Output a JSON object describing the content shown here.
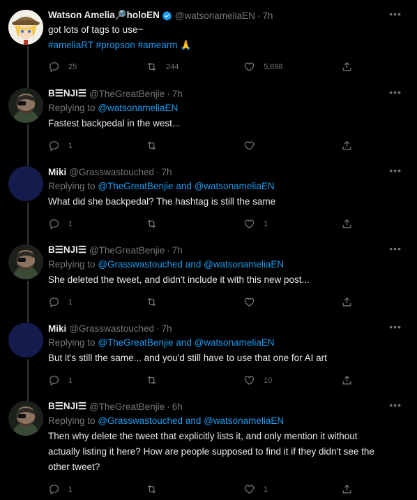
{
  "tweets": [
    {
      "name": "Watson Amelia🔎holoEN",
      "verified": true,
      "handle": "@watsonameliaEN",
      "time": "7h",
      "replying_to": null,
      "text_lines": [
        "got lots of tags to use~"
      ],
      "hashtags": "#ameliaRT #propson #amearm 🙏",
      "replies": "25",
      "retweets": "244",
      "likes": "5,698"
    },
    {
      "name": "B☰NJI☰",
      "handle": "@TheGreatBenjie",
      "time": "7h",
      "replying_label": "Replying to",
      "replying_to": "@watsonameliaEN",
      "text_lines": [
        "Fastest backpedal in the west..."
      ],
      "replies": "1",
      "retweets": "",
      "likes": ""
    },
    {
      "name": "Miki",
      "handle": "@Grasswastouched",
      "time": "7h",
      "replying_label": "Replying to",
      "replying_to": "@TheGreatBenjie and @watsonameliaEN",
      "text_lines": [
        "What did she backpedal? The hashtag is still the same"
      ],
      "replies": "1",
      "retweets": "",
      "likes": "1"
    },
    {
      "name": "B☰NJI☰",
      "handle": "@TheGreatBenjie",
      "time": "7h",
      "replying_label": "Replying to",
      "replying_to": "@Grasswastouched and @watsonameliaEN",
      "text_lines": [
        "She deleted the tweet, and didn't include it with this new post..."
      ],
      "replies": "1",
      "retweets": "",
      "likes": ""
    },
    {
      "name": "Miki",
      "handle": "@Grasswastouched",
      "time": "7h",
      "replying_label": "Replying to",
      "replying_to": "@TheGreatBenjie and @watsonameliaEN",
      "text_lines": [
        "But it's still the same... and you'd still have to use that one for AI art"
      ],
      "replies": "1",
      "retweets": "",
      "likes": "10"
    },
    {
      "name": "B☰NJI☰",
      "handle": "@TheGreatBenjie",
      "time": "6h",
      "replying_label": "Replying to",
      "replying_to": "@Grasswastouched and @watsonameliaEN",
      "text_lines": [
        "Then why delete the tweet that explicitly lists it, and only mention it without",
        "actually listing it here? How are people supposed to find it if they didn't see the",
        "other tweet?"
      ],
      "replies": "1",
      "retweets": "",
      "likes": "1"
    }
  ],
  "colors": {
    "background": "#000000",
    "text": "#e7e9ea",
    "muted": "#71767b",
    "link": "#1d9bf0",
    "verified": "#1d9bf0"
  },
  "icons": [
    "reply-icon",
    "retweet-icon",
    "like-icon",
    "share-icon",
    "more-icon",
    "verified-icon"
  ]
}
